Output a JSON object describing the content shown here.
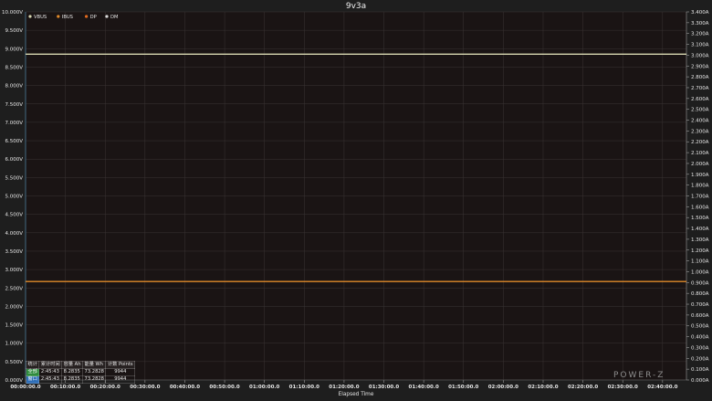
{
  "chart_data": {
    "type": "line",
    "title": "9v3a",
    "xlabel": "Elapsed Time",
    "x_ticks": [
      "00:00:00.0",
      "00:10:00.0",
      "00:20:00.0",
      "00:30:00.0",
      "00:40:00.0",
      "00:50:00.0",
      "01:00:00.0",
      "01:10:00.0",
      "01:20:00.0",
      "01:30:00.0",
      "01:40:00.0",
      "01:50:00.0",
      "02:00:00.0",
      "02:10:00.0",
      "02:20:00.0",
      "02:30:00.0",
      "02:40:00.0"
    ],
    "x_range_minutes": [
      0,
      166
    ],
    "y_left": {
      "unit": "V",
      "range": [
        0,
        10
      ],
      "ticks": [
        "0.000V",
        "0.500V",
        "1.000V",
        "1.500V",
        "2.000V",
        "2.500V",
        "3.000V",
        "3.500V",
        "4.000V",
        "4.500V",
        "5.000V",
        "5.500V",
        "6.000V",
        "6.500V",
        "7.000V",
        "7.500V",
        "8.000V",
        "8.500V",
        "9.000V",
        "9.500V",
        "10.000V"
      ]
    },
    "y_right": {
      "unit": "A",
      "range": [
        0,
        3.4
      ],
      "ticks": [
        "0.000A",
        "0.100A",
        "0.200A",
        "0.300A",
        "0.400A",
        "0.500A",
        "0.600A",
        "0.700A",
        "0.800A",
        "0.900A",
        "1.000A",
        "1.100A",
        "1.200A",
        "1.300A",
        "1.400A",
        "1.500A",
        "1.600A",
        "1.700A",
        "1.800A",
        "1.900A",
        "2.000A",
        "2.100A",
        "2.200A",
        "2.300A",
        "2.400A",
        "2.500A",
        "2.600A",
        "2.700A",
        "2.800A",
        "2.900A",
        "3.000A",
        "3.100A",
        "3.200A",
        "3.300A",
        "3.400A"
      ]
    },
    "grid": true,
    "legend_position": "top-left",
    "series": [
      {
        "name": "VBUS",
        "axis": "left",
        "color": "#d7d7b0",
        "x": [
          0,
          166
        ],
        "values": [
          8.85,
          8.85
        ]
      },
      {
        "name": "IBUS",
        "axis": "right",
        "color": "#e08a2a",
        "x": [
          0,
          166
        ],
        "values": [
          0.91,
          0.91
        ]
      },
      {
        "name": "DP",
        "axis": "left",
        "color": "#e46b1f",
        "x": [],
        "values": []
      },
      {
        "name": "DM",
        "axis": "left",
        "color": "#d9d9d9",
        "x": [],
        "values": []
      }
    ]
  },
  "stats_table": {
    "header": [
      "统计",
      "累计时间",
      "容量 Ah",
      "能量 Wh",
      "计数 Points"
    ],
    "rows": [
      {
        "tag": "全部",
        "tag_color": "#2e8b3d",
        "values": [
          "2:45:43",
          "8.2835",
          "73.2828",
          "9944"
        ]
      },
      {
        "tag": "窗口",
        "tag_color": "#2f6fb8",
        "values": [
          "2:45:43",
          "8.2835",
          "73.2828",
          "9944"
        ]
      }
    ]
  },
  "watermark": "POWER-Z"
}
